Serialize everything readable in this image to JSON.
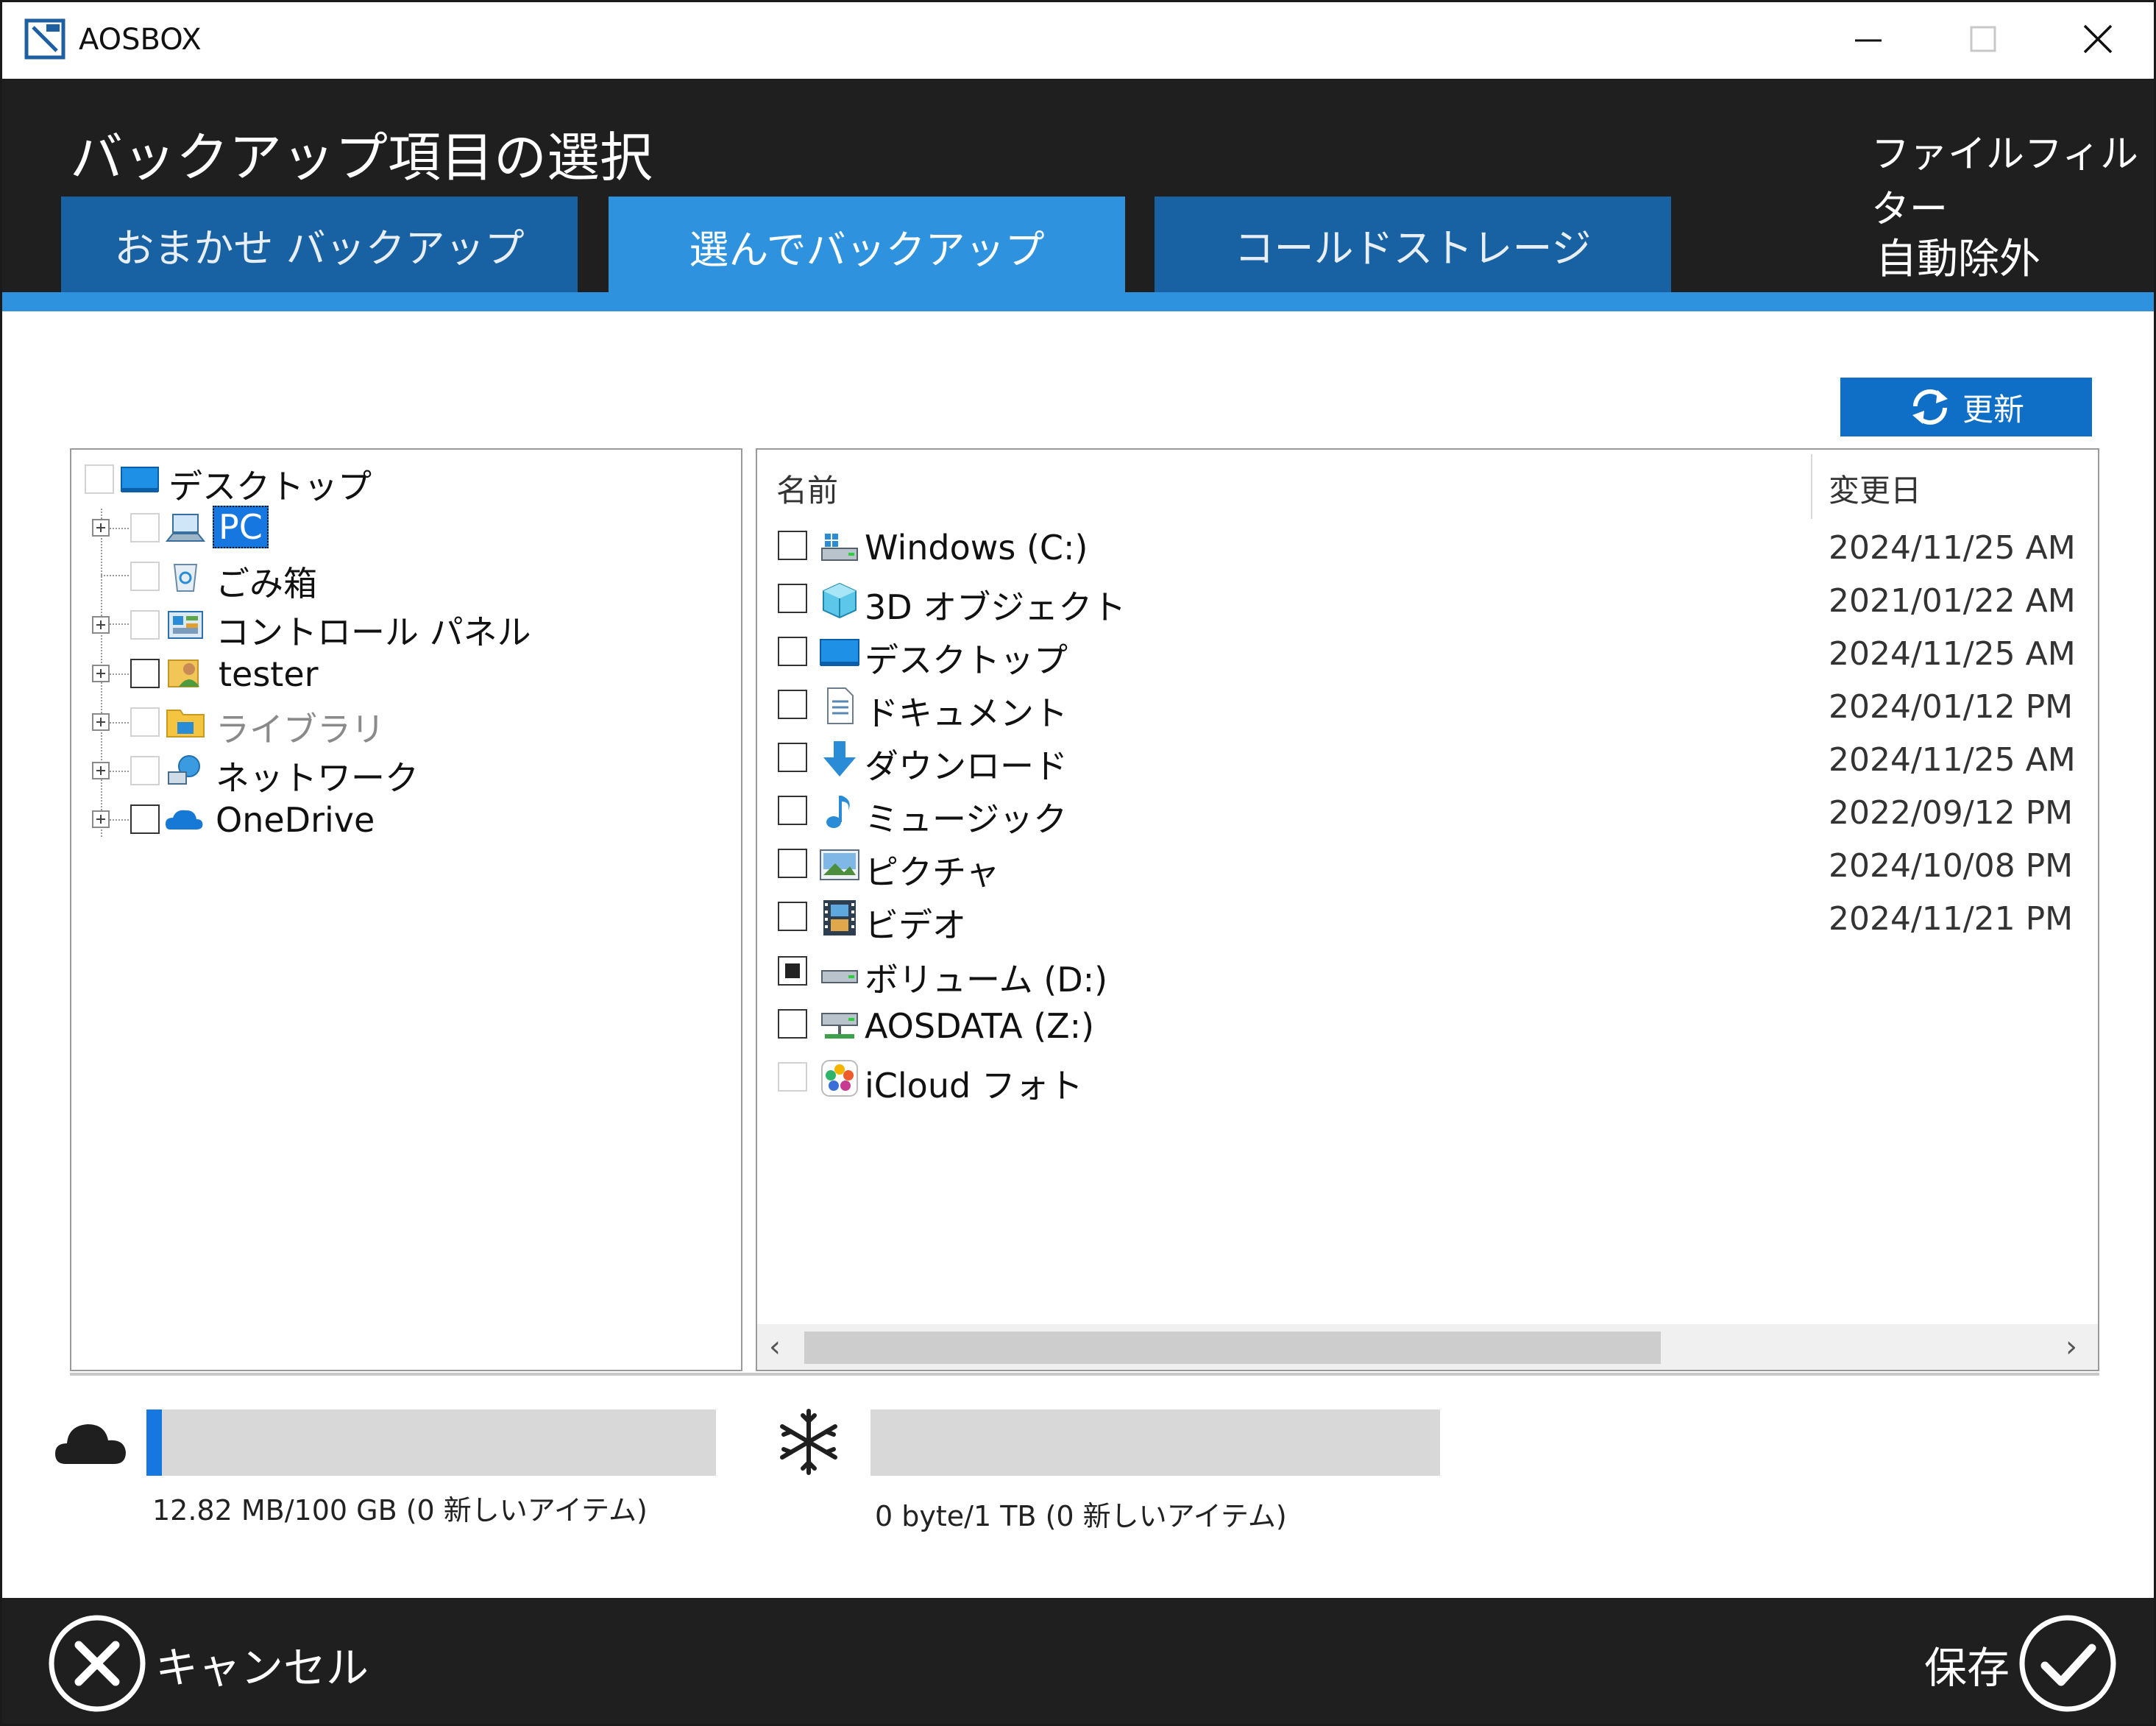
{
  "window": {
    "title": "AOSBOX"
  },
  "header": {
    "page_title": "バックアップ項目の選択",
    "file_filter": "ファイルフィルター",
    "auto_exclude": "自動除外",
    "tabs": [
      {
        "label": "おまかせ バックアップ",
        "active": false
      },
      {
        "label": "選んでバックアップ",
        "active": true
      },
      {
        "label": "コールドストレージ",
        "active": false
      }
    ]
  },
  "toolbar": {
    "refresh_label": "更新"
  },
  "tree": {
    "items": [
      {
        "label": "デスクトップ",
        "icon": "desktop-icon",
        "level": 0,
        "expandable": false,
        "checkbox": "dim"
      },
      {
        "label": "PC",
        "icon": "pc-icon",
        "level": 1,
        "expandable": true,
        "checkbox": "dim",
        "selected": true
      },
      {
        "label": "ごみ箱",
        "icon": "recycle-bin-icon",
        "level": 1,
        "expandable": false,
        "checkbox": "dim"
      },
      {
        "label": "コントロール パネル",
        "icon": "control-panel-icon",
        "level": 1,
        "expandable": true,
        "checkbox": "dim"
      },
      {
        "label": "tester",
        "icon": "user-icon",
        "level": 1,
        "expandable": true,
        "checkbox": "normal"
      },
      {
        "label": "ライブラリ",
        "icon": "library-icon",
        "level": 1,
        "expandable": true,
        "checkbox": "dim",
        "grey": true
      },
      {
        "label": "ネットワーク",
        "icon": "network-icon",
        "level": 1,
        "expandable": true,
        "checkbox": "dim"
      },
      {
        "label": "OneDrive",
        "icon": "onedrive-icon",
        "level": 1,
        "expandable": true,
        "checkbox": "normal"
      }
    ]
  },
  "list": {
    "columns": {
      "name": "名前",
      "date": "変更日"
    },
    "rows": [
      {
        "name": "Windows (C:)",
        "date": "2024/11/25 AM",
        "icon": "drive-c-icon",
        "checkbox": "normal"
      },
      {
        "name": "3D オブジェクト",
        "date": "2021/01/22 AM",
        "icon": "3d-objects-icon",
        "checkbox": "normal"
      },
      {
        "name": "デスクトップ",
        "date": "2024/11/25 AM",
        "icon": "desktop-icon",
        "checkbox": "normal"
      },
      {
        "name": "ドキュメント",
        "date": "2024/01/12 PM",
        "icon": "documents-icon",
        "checkbox": "normal"
      },
      {
        "name": "ダウンロード",
        "date": "2024/11/25 AM",
        "icon": "downloads-icon",
        "checkbox": "normal"
      },
      {
        "name": "ミュージック",
        "date": "2022/09/12 PM",
        "icon": "music-icon",
        "checkbox": "normal"
      },
      {
        "name": "ピクチャ",
        "date": "2024/10/08 PM",
        "icon": "pictures-icon",
        "checkbox": "normal"
      },
      {
        "name": "ビデオ",
        "date": "2024/11/21 PM",
        "icon": "videos-icon",
        "checkbox": "normal"
      },
      {
        "name": "ボリューム (D:)",
        "date": "",
        "icon": "drive-d-icon",
        "checkbox": "partial"
      },
      {
        "name": "AOSDATA (Z:)",
        "date": "",
        "icon": "network-drive-icon",
        "checkbox": "normal"
      },
      {
        "name": "iCloud フォト",
        "date": "",
        "icon": "icloud-photos-icon",
        "checkbox": "dim"
      }
    ]
  },
  "quota": {
    "cloud": {
      "text": "12.82 MB/100 GB (0 新しいアイテム)",
      "fill_fraction": 0.027
    },
    "cold": {
      "text": "0 byte/1 TB (0 新しいアイテム)",
      "fill_fraction": 0
    }
  },
  "footer": {
    "cancel_label": "キャンセル",
    "save_label": "保存"
  },
  "colors": {
    "accent": "#2e92de",
    "tab_dark": "#1862a3",
    "header_bg": "#1f1f1f",
    "selection": "#1677e0"
  }
}
